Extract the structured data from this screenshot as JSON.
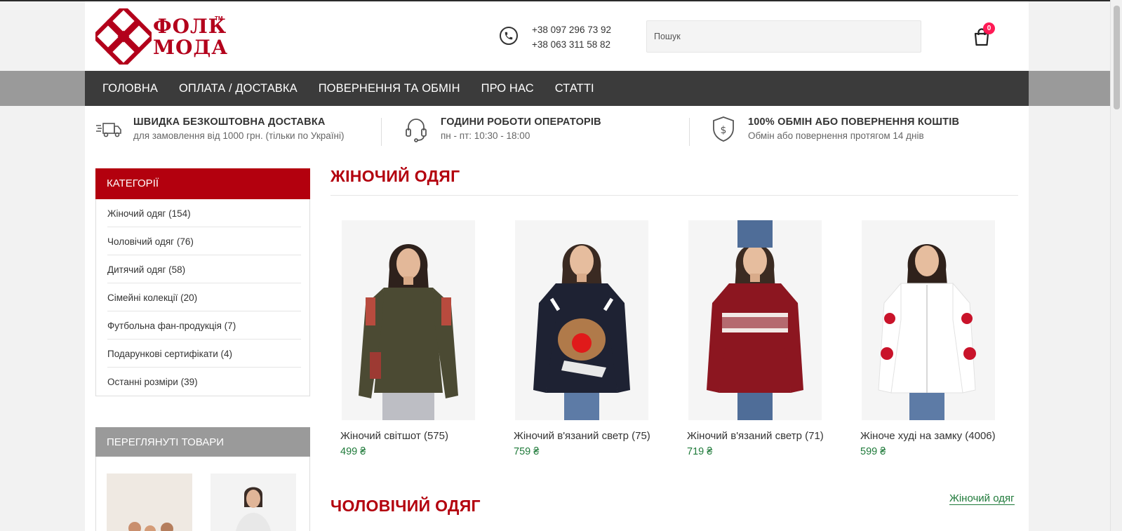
{
  "brand": {
    "word1": "ФОЛК",
    "word2": "МОДА",
    "tm": "TM"
  },
  "contacts": {
    "phones": [
      "+38 097 296 73 92",
      "+38 063 311 58 82"
    ]
  },
  "search": {
    "placeholder": "Пошук"
  },
  "cart": {
    "count": "0"
  },
  "nav": [
    "ГОЛОВНА",
    "ОПЛАТА / ДОСТАВКА",
    "ПОВЕРНЕННЯ ТА ОБМІН",
    "ПРО НАС",
    "СТАТТІ"
  ],
  "info": [
    {
      "title": "ШВИДКА БЕЗКОШТОВНА ДОСТАВКА",
      "text": "для замовлення від 1000 грн. (тільки по Україні)",
      "icon": "truck-icon"
    },
    {
      "title": "ГОДИНИ РОБОТИ ОПЕРАТОРІВ",
      "text": "пн - пт: 10:30 - 18:00",
      "icon": "headset-icon"
    },
    {
      "title": "100% ОБМІН АБО ПОВЕРНЕННЯ КОШТІВ",
      "text": "Обмін або повернення протягом 14 днів",
      "icon": "shield-dollar-icon"
    }
  ],
  "sidebar": {
    "categories_title": "КАТЕГОРІЇ",
    "categories": [
      "Жіночий одяг (154)",
      "Чоловічий одяг (76)",
      "Дитячий одяг (58)",
      "Сімейні колекції (20)",
      "Футбольна фан-продукція (7)",
      "Подарункові сертифікати (4)",
      "Останні розміри (39)"
    ],
    "viewed_title": "ПЕРЕГЛЯНУТІ ТОВАРИ"
  },
  "sections": [
    {
      "title": "ЖІНОЧИЙ ОДЯГ",
      "more_link": "Жіночий одяг",
      "products": [
        {
          "name": "Жіночий світшот (575)",
          "price": "499 ₴"
        },
        {
          "name": "Жіночий в'язаний светр (75)",
          "price": "759 ₴"
        },
        {
          "name": "Жіночий в'язаний светр (71)",
          "price": "719 ₴"
        },
        {
          "name": "Жіноче худі на замку (4006)",
          "price": "599 ₴"
        }
      ]
    },
    {
      "title": "ЧОЛОВІЧИЙ ОДЯГ"
    }
  ],
  "colors": {
    "brand_red": "#b3000e",
    "nav_dark": "#3b3b3b",
    "price_green": "#1f7a3a",
    "badge_pink": "#ff1a55"
  }
}
